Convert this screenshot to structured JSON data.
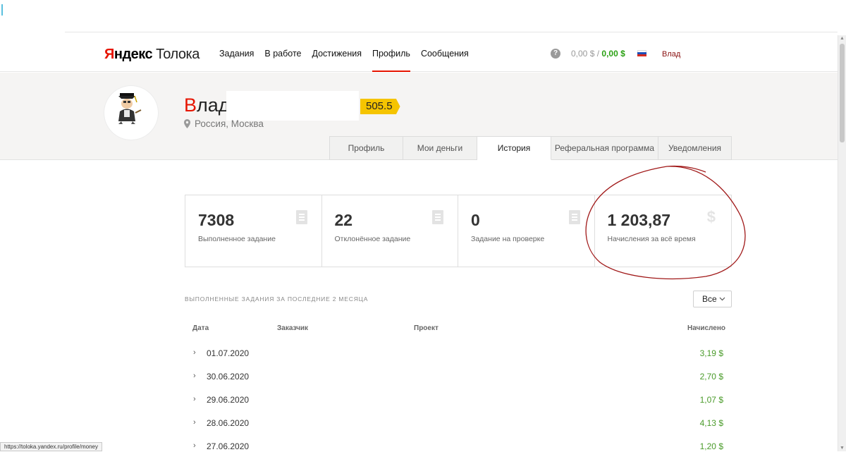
{
  "logo": {
    "ya": "Я",
    "rest": "ндекс",
    "product": "Толока"
  },
  "nav": [
    {
      "label": "Задания",
      "active": false
    },
    {
      "label": "В работе",
      "active": false
    },
    {
      "label": "Достижения",
      "active": false
    },
    {
      "label": "Профиль",
      "active": true
    },
    {
      "label": "Сообщения",
      "active": false
    }
  ],
  "header": {
    "help_icon": "question-circle-icon",
    "help_glyph": "?",
    "balance_hold": "0,00 $",
    "balance_sep": " / ",
    "balance_available": "0,00 $",
    "username": "Влад"
  },
  "profile": {
    "name_first_letter": "В",
    "name_rest": "лад",
    "rating": "505.5",
    "location": "Россия, Москва"
  },
  "tabs": [
    {
      "label": "Профиль",
      "active": false
    },
    {
      "label": "Мои деньги",
      "active": false
    },
    {
      "label": "История",
      "active": true
    },
    {
      "label": "Реферальная программа",
      "active": false
    },
    {
      "label": "Уведомления",
      "active": false
    }
  ],
  "stats": [
    {
      "value": "7308",
      "label": "Выполненное задание",
      "icon": "document-icon"
    },
    {
      "value": "22",
      "label": "Отклонённое задание",
      "icon": "document-icon"
    },
    {
      "value": "0",
      "label": "Задание на проверке",
      "icon": "document-icon"
    },
    {
      "value": "1 203,87",
      "label": "Начисления за всё время",
      "icon": "dollar-icon",
      "icon_glyph": "$"
    }
  ],
  "history": {
    "title": "ВЫПОЛНЕННЫЕ ЗАДАНИЯ ЗА ПОСЛЕДНИЕ 2 МЕСЯЦА",
    "filter": "Все",
    "columns": {
      "date": "Дата",
      "client": "Заказчик",
      "project": "Проект",
      "earned": "Начислено"
    },
    "rows": [
      {
        "date": "01.07.2020",
        "amount": "3,19 $"
      },
      {
        "date": "30.06.2020",
        "amount": "2,70 $"
      },
      {
        "date": "29.06.2020",
        "amount": "1,07 $"
      },
      {
        "date": "28.06.2020",
        "amount": "4,13 $"
      },
      {
        "date": "27.06.2020",
        "amount": "1,20 $"
      }
    ]
  },
  "status_bar_url": "https://toloka.yandex.ru/profile/money",
  "colors": {
    "accent_red": "#e61400",
    "money_green": "#2ba114",
    "rating_yellow": "#f5c400",
    "annotation": "#a01818"
  }
}
